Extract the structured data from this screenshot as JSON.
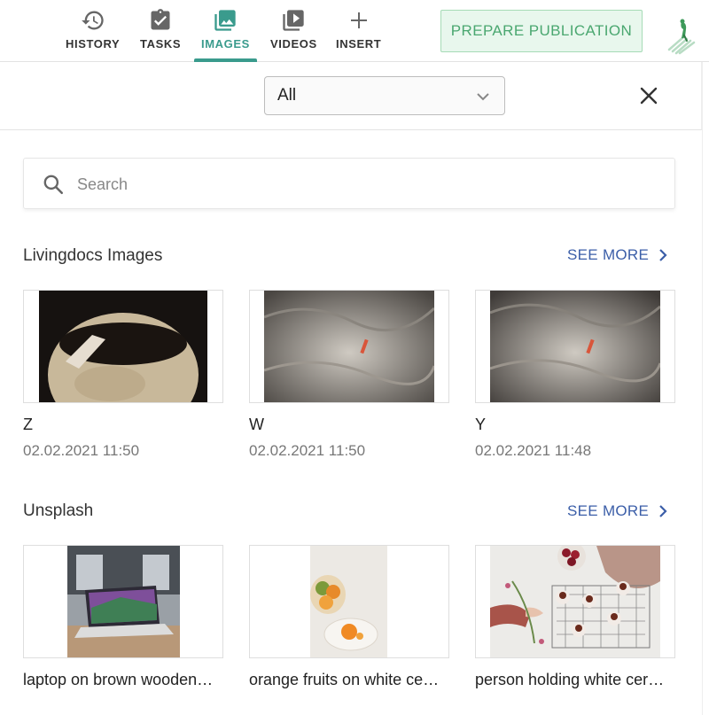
{
  "nav": {
    "tabs": [
      {
        "label": "HISTORY",
        "icon": "history-icon"
      },
      {
        "label": "TASKS",
        "icon": "clipboard-check-icon"
      },
      {
        "label": "IMAGES",
        "icon": "image-icon",
        "active": true
      },
      {
        "label": "VIDEOS",
        "icon": "video-library-icon"
      },
      {
        "label": "INSERT",
        "icon": "plus-icon"
      }
    ],
    "publish_label": "PREPARE PUBLICATION"
  },
  "filter": {
    "selected": "All"
  },
  "search": {
    "placeholder": "Search",
    "value": ""
  },
  "sections": [
    {
      "title": "Livingdocs Images",
      "see_more": "SEE MORE",
      "items": [
        {
          "caption": "Z",
          "date": "02.02.2021 11:50"
        },
        {
          "caption": "W",
          "date": "02.02.2021 11:50"
        },
        {
          "caption": "Y",
          "date": "02.02.2021 11:48"
        }
      ]
    },
    {
      "title": "Unsplash",
      "see_more": "SEE MORE",
      "items": [
        {
          "caption": "laptop on brown wooden…"
        },
        {
          "caption": "orange fruits on white ce…"
        },
        {
          "caption": "person holding white cer…"
        }
      ]
    }
  ],
  "colors": {
    "accent": "#3a9b8d",
    "link": "#3b5ea8",
    "publish_bg": "#e8f7ed",
    "publish_text": "#4aa770"
  }
}
